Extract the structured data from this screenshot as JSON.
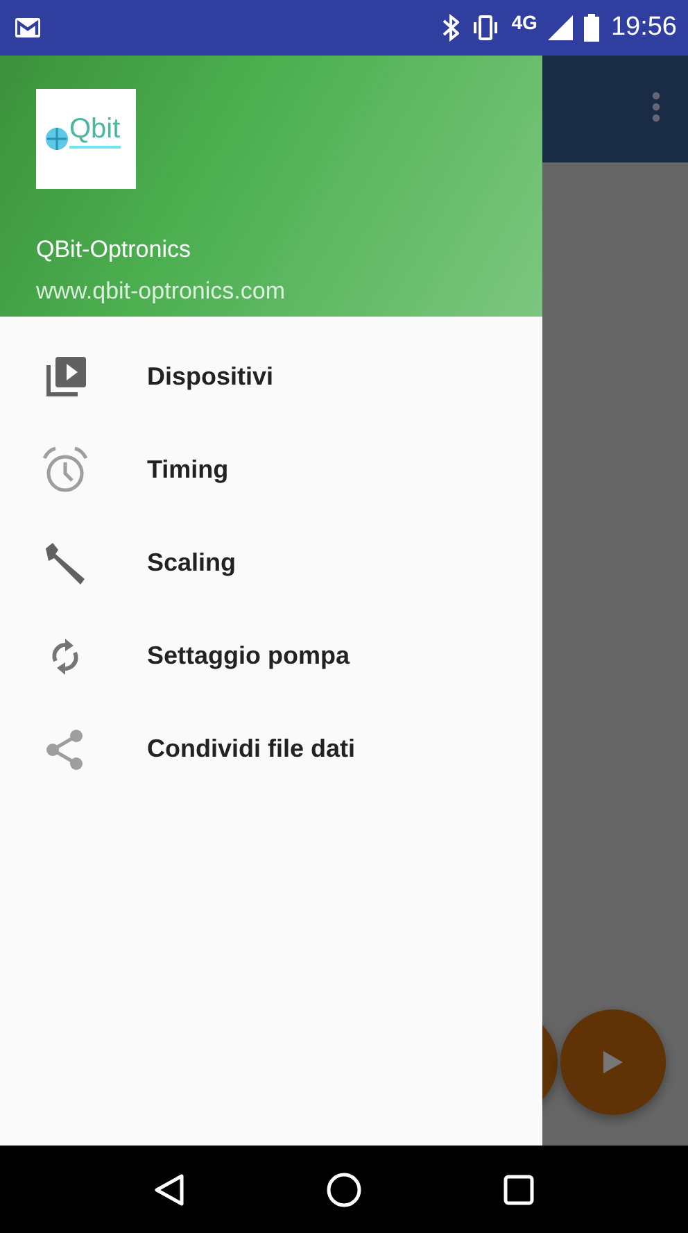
{
  "status_bar": {
    "network": "4G",
    "time": "19:56"
  },
  "drawer": {
    "logo_text": "Qbit",
    "title": "QBit-Optronics",
    "subtitle": "www.qbit-optronics.com",
    "items": [
      {
        "label": "Dispositivi"
      },
      {
        "label": "Timing"
      },
      {
        "label": "Scaling"
      },
      {
        "label": "Settaggio pompa"
      },
      {
        "label": "Condividi file dati"
      }
    ]
  }
}
